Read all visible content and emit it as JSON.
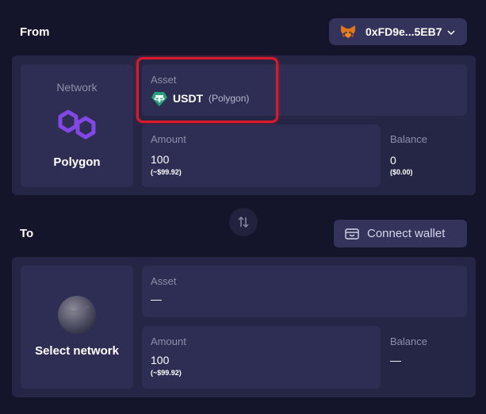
{
  "from": {
    "title": "From",
    "wallet": {
      "address": "0xFD9e...5EB7",
      "icon": "metamask-fox-icon"
    },
    "network": {
      "label": "Network",
      "name": "Polygon",
      "icon": "polygon-icon",
      "color": "#8247e5"
    },
    "asset": {
      "label": "Asset",
      "symbol": "USDT",
      "chain": "(Polygon)",
      "icon": "tether-icon",
      "color": "#26a17b"
    },
    "amount": {
      "label": "Amount",
      "value": "100",
      "usd": "(~$99.92)"
    },
    "balance": {
      "label": "Balance",
      "value": "0",
      "usd": "($0.00)"
    }
  },
  "swap": {
    "icon": "swap-arrows-icon"
  },
  "to": {
    "title": "To",
    "connect_label": "Connect wallet",
    "network": {
      "name": "Select network",
      "icon": "placeholder-globe-icon"
    },
    "asset": {
      "label": "Asset",
      "value": "—"
    },
    "amount": {
      "label": "Amount",
      "value": "100",
      "usd": "(~$99.92)"
    },
    "balance": {
      "label": "Balance",
      "value": "—"
    }
  },
  "colors": {
    "highlight": "#d81a2a",
    "background": "#14142b",
    "card": "#252545"
  }
}
